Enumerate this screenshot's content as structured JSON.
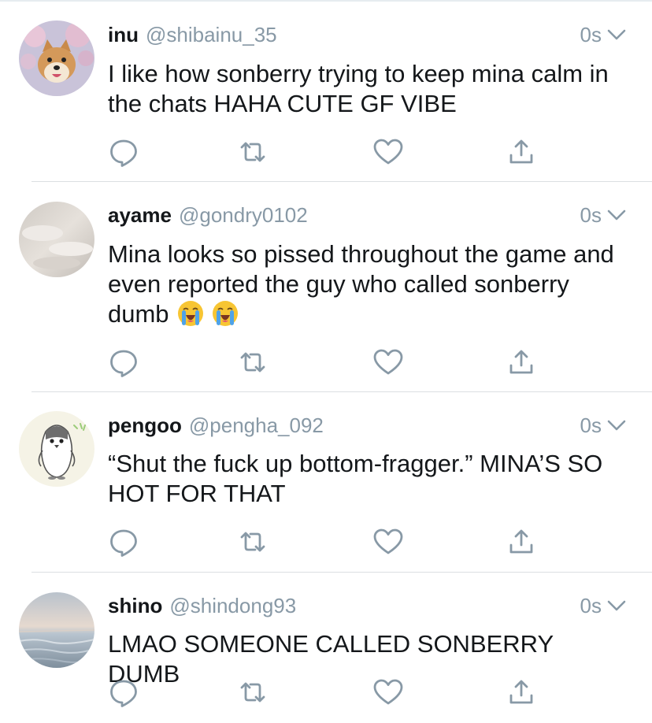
{
  "tweets": [
    {
      "name": "inu",
      "handle": "@shibainu_35",
      "time": "0s",
      "text": "I like how sonberry trying to keep mina calm in the chats HAHA CUTE GF VIBE",
      "emojis": []
    },
    {
      "name": "ayame",
      "handle": "@gondry0102",
      "time": "0s",
      "text": "Mina looks so pissed throughout the game and even reported the guy who called sonberry dumb",
      "emojis": [
        "loudly-crying-face",
        "loudly-crying-face"
      ]
    },
    {
      "name": "pengoo",
      "handle": "@pengha_092",
      "time": "0s",
      "text": "“Shut the fuck up bottom-fragger.” MINA’S SO HOT FOR THAT",
      "emojis": []
    },
    {
      "name": "shino",
      "handle": "@shindong93",
      "time": "0s",
      "text": "LMAO SOMEONE CALLED SONBERRY DUMB",
      "emojis": []
    }
  ],
  "icons": {
    "reply": "reply-icon",
    "retweet": "retweet-icon",
    "like": "like-icon",
    "share": "share-icon",
    "more": "chevron-down-icon"
  },
  "colors": {
    "text": "#14171a",
    "secondary": "#8899a6",
    "divider": "#dcdfe2"
  }
}
